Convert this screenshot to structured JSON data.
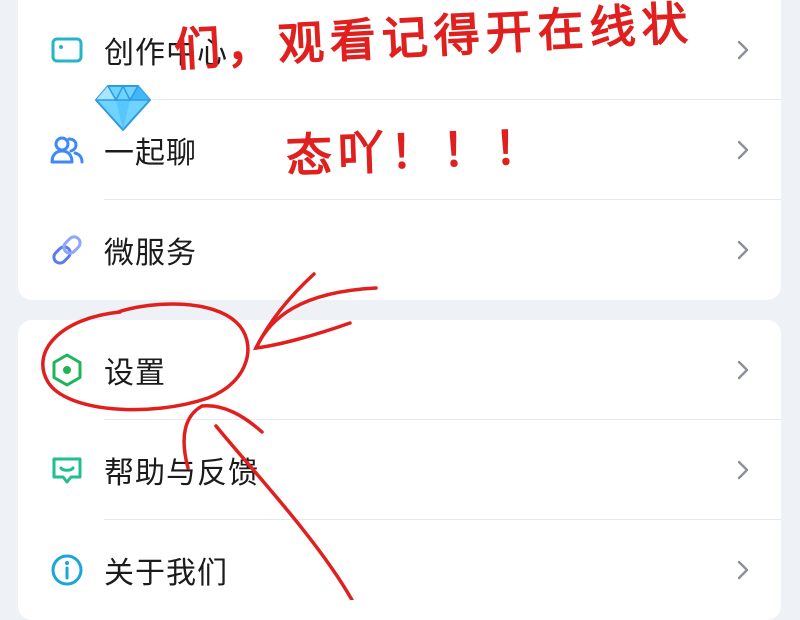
{
  "menu_top": [
    {
      "label": "创作中心",
      "icon": "creator-center-icon"
    },
    {
      "label": "一起聊",
      "icon": "chat-together-icon"
    },
    {
      "label": "微服务",
      "icon": "micro-service-icon"
    }
  ],
  "menu_bottom": [
    {
      "label": "设置",
      "icon": "settings-hexagon-icon"
    },
    {
      "label": "帮助与反馈",
      "icon": "help-feedback-icon"
    },
    {
      "label": "关于我们",
      "icon": "about-us-info-icon"
    }
  ],
  "annotation": {
    "line1": "们，观看记得开在线状",
    "line2": "态吖！！！",
    "sticker": "gem-diamond-icon",
    "color": "#e0201e"
  },
  "colors": {
    "background": "#eef1f6",
    "card": "#ffffff",
    "text": "#1b1b1b",
    "chevron": "#8a8f99",
    "creator_icon": "#23b6c6",
    "chat_icon": "#3d8af7",
    "service_icon": "#5b7cf0",
    "settings_icon": "#20b45a",
    "help_icon": "#1fbf8f",
    "about_icon": "#1aa6d8"
  }
}
